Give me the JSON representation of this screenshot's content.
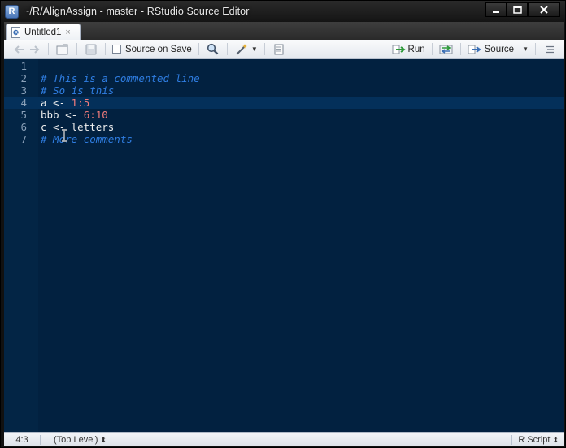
{
  "window": {
    "title": "~/R/AlignAssign - master - RStudio Source Editor"
  },
  "tabs": [
    {
      "label": "Untitled1",
      "close": "×"
    }
  ],
  "toolbar": {
    "source_on_save_label": "Source on Save",
    "source_on_save_checked": false,
    "run_label": "Run",
    "source_label": "Source"
  },
  "editor": {
    "lines": [
      {
        "number": "1",
        "tokens": []
      },
      {
        "number": "2",
        "tokens": [
          {
            "type": "comment",
            "text": "# This is a commented line"
          }
        ]
      },
      {
        "number": "3",
        "tokens": [
          {
            "type": "comment",
            "text": "# So is this"
          }
        ]
      },
      {
        "number": "4",
        "tokens": [
          {
            "type": "text",
            "text": "a <- "
          },
          {
            "type": "number",
            "text": "1:5"
          }
        ]
      },
      {
        "number": "5",
        "tokens": [
          {
            "type": "text",
            "text": "bbb <- "
          },
          {
            "type": "number",
            "text": "6:10"
          }
        ]
      },
      {
        "number": "6",
        "tokens": [
          {
            "type": "text",
            "text": "c <- letters"
          }
        ]
      },
      {
        "number": "7",
        "tokens": [
          {
            "type": "comment",
            "text": "# More comments"
          }
        ]
      }
    ],
    "active_line": 4,
    "colors": {
      "background": "#022140",
      "comment": "#2f7de1",
      "number": "#f07b7b",
      "text": "#f0f0f0"
    }
  },
  "status": {
    "cursor_position": "4:3",
    "scope": "(Top Level)",
    "updown": "⬍",
    "file_type": "R Script"
  },
  "icons": {
    "app": "rstudio-icon",
    "run": "run-arrow-icon",
    "source": "source-arrow-icon"
  }
}
